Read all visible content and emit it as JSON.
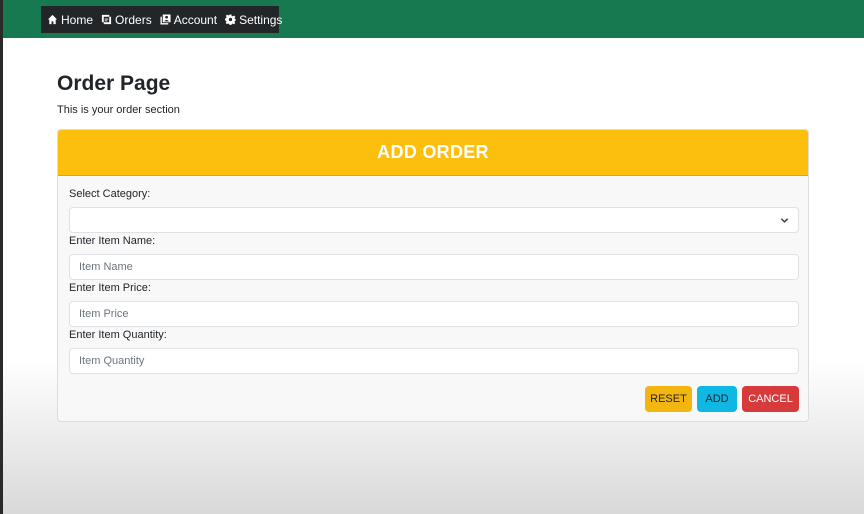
{
  "nav": {
    "items": [
      {
        "label": "Home",
        "icon": "home-icon"
      },
      {
        "label": "Orders",
        "icon": "orders-icon"
      },
      {
        "label": "Account",
        "icon": "account-icon"
      },
      {
        "label": "Settings",
        "icon": "settings-icon"
      }
    ]
  },
  "page": {
    "title": "Order Page",
    "subtitle": "This is your order section"
  },
  "form": {
    "header": "ADD ORDER",
    "category_label": "Select Category:",
    "category_value": "",
    "item_name_label": "Enter Item Name:",
    "item_name_placeholder": "Item Name",
    "item_price_label": "Enter Item Price:",
    "item_price_placeholder": "Item Price",
    "item_quantity_label": "Enter Item Quantity:",
    "item_quantity_placeholder": "Item Quantity",
    "reset_label": "RESET",
    "add_label": "ADD",
    "cancel_label": "CANCEL"
  },
  "colors": {
    "topbar": "#17794f",
    "nav_bg": "#222629",
    "header": "#fdbf0e",
    "reset": "#f3b611",
    "add": "#0fb8e3",
    "cancel": "#d63a3a"
  }
}
